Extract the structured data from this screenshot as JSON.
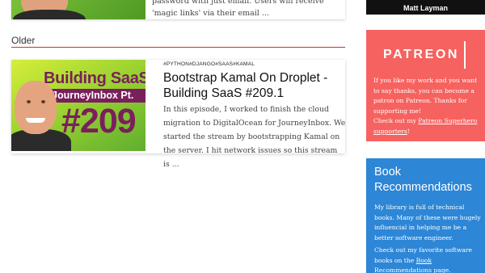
{
  "top_post": {
    "excerpt": "password with just email. Users will receive 'magic links' via their email ..."
  },
  "section": {
    "heading": "Older"
  },
  "post": {
    "tags": "#PYTHON#DJANGO#SAAS#KAMAL",
    "title": "Bootstrap Kamal On Droplet - Building SaaS #209.1",
    "excerpt": "In this episode, I worked to finish the cloud migration to DigitalOcean for JourneyInbox. We started the stream by bootstrapping Kamal on the server. I hit network issues so this stream is ...",
    "thumbnail": {
      "line1": "Building SaaS",
      "line2": "JourneyInbox Pt.",
      "line3": "#209"
    }
  },
  "sidebar": {
    "video": {
      "name": "Matt Layman"
    },
    "patreon": {
      "logo": "PATREON",
      "text": "If you like my work and you want to say thanks, you can become a patron on Patreon. Thanks for supporting me!",
      "text2_prefix": "Check out my ",
      "link": "Patreon Superhero supporters",
      "text2_suffix": "!",
      "color": "#f6625f"
    },
    "books": {
      "title": "Book Recommendations",
      "text": "My library is full of technical books. Many of these were hugely influencial in helping me be a better software engineer.",
      "text2_prefix": "Check out my favorite software books on the ",
      "link": "Book Recommendations",
      "text2_suffix": " page.",
      "color": "#2d86d6"
    }
  },
  "colors": {
    "accent_rule": "#c0392b",
    "thumbnail_purple": "#7a1f5c"
  }
}
